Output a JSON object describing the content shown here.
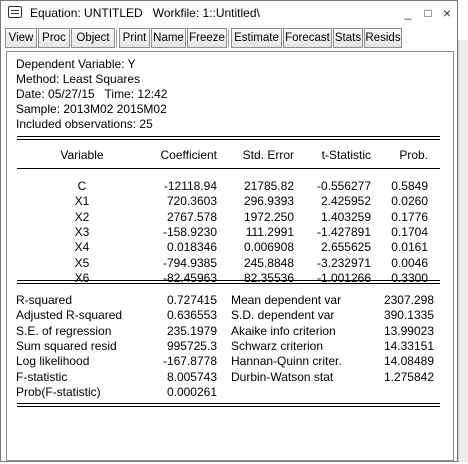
{
  "window": {
    "title": "Equation: UNTITLED   Workfile: 1::Untitled\\",
    "minimize": "_",
    "maximize": "□",
    "close": "×"
  },
  "toolbar": [
    "View",
    "Proc",
    "Object",
    "Print",
    "Name",
    "Freeze",
    "Estimate",
    "Forecast",
    "Stats",
    "Resids"
  ],
  "header": {
    "dependent": "Dependent Variable: Y",
    "method": "Method: Least Squares",
    "date": "Date: 05/27/15   Time: 12:42",
    "sample": "Sample: 2013M02 2015M02",
    "obs": "Included observations: 25"
  },
  "table": {
    "columns": [
      "Variable",
      "Coefficient",
      "Std. Error",
      "t-Statistic",
      "Prob."
    ],
    "rows": [
      [
        "C",
        "-12118.94",
        "21785.82",
        "-0.556277",
        "0.5849"
      ],
      [
        "X1",
        "720.3603",
        "296.9393",
        "2.425952",
        "0.0260"
      ],
      [
        "X2",
        "2767.578",
        "1972.250",
        "1.403259",
        "0.1776"
      ],
      [
        "X3",
        "-158.9230",
        "111.2991",
        "-1.427891",
        "0.1704"
      ],
      [
        "X4",
        "0.018346",
        "0.006908",
        "2.655625",
        "0.0161"
      ],
      [
        "X5",
        "-794.9385",
        "245.8848",
        "-3.232971",
        "0.0046"
      ],
      [
        "X6",
        "-82.45963",
        "82.35536",
        "-1.001266",
        "0.3300"
      ]
    ]
  },
  "stats": {
    "left": [
      [
        "R-squared",
        "0.727415"
      ],
      [
        "Adjusted R-squared",
        "0.636553"
      ],
      [
        "S.E. of regression",
        "235.1979"
      ],
      [
        "Sum squared resid",
        "995725.3"
      ],
      [
        "Log likelihood",
        "-167.8778"
      ],
      [
        "F-statistic",
        "8.005743"
      ],
      [
        "Prob(F-statistic)",
        "0.000261"
      ]
    ],
    "right": [
      [
        "Mean dependent var",
        "2307.298"
      ],
      [
        "S.D. dependent var",
        "390.1335"
      ],
      [
        "Akaike info criterion",
        "13.99023"
      ],
      [
        "Schwarz criterion",
        "14.33151"
      ],
      [
        "Hannan-Quinn criter.",
        "14.08489"
      ],
      [
        "Durbin-Watson stat",
        "1.275842"
      ]
    ]
  }
}
